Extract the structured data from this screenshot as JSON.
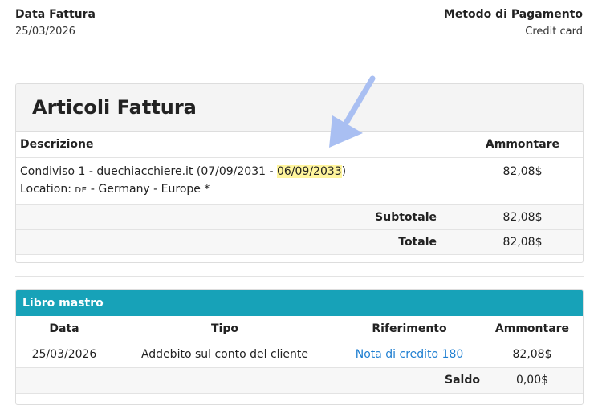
{
  "header": {
    "date_label": "Data Fattura",
    "date_value": "25/03/2026",
    "payment_label": "Metodo di Pagamento",
    "payment_value": "Credit card"
  },
  "items_panel": {
    "title": "Articoli Fattura",
    "columns": {
      "description": "Descrizione",
      "amount": "Ammontare"
    },
    "item": {
      "desc_prefix": "Condiviso 1 - duechiacchiere.it (07/09/2031 - ",
      "desc_highlight": "06/09/2033",
      "desc_suffix": ")",
      "location_label": "Location: ",
      "location_code": "DE",
      "location_rest": " - Germany - Europe *",
      "amount": "82,08$"
    },
    "subtotal_label": "Subtotale",
    "subtotal_value": "82,08$",
    "total_label": "Totale",
    "total_value": "82,08$"
  },
  "ledger": {
    "title": "Libro mastro",
    "columns": {
      "date": "Data",
      "type": "Tipo",
      "reference": "Riferimento",
      "amount": "Ammontare"
    },
    "row": {
      "date": "25/03/2026",
      "type": "Addebito sul conto del cliente",
      "reference": "Nota di credito 180",
      "amount": "82,08$"
    },
    "balance_label": "Saldo",
    "balance_value": "0,00$"
  },
  "colors": {
    "ledger_header": "#17a2b8",
    "link": "#1f7fd1",
    "highlight": "#fff59d",
    "annotation_arrow": "#a9bff2"
  },
  "annotation": {
    "icon": "arrow-down-left-icon"
  }
}
